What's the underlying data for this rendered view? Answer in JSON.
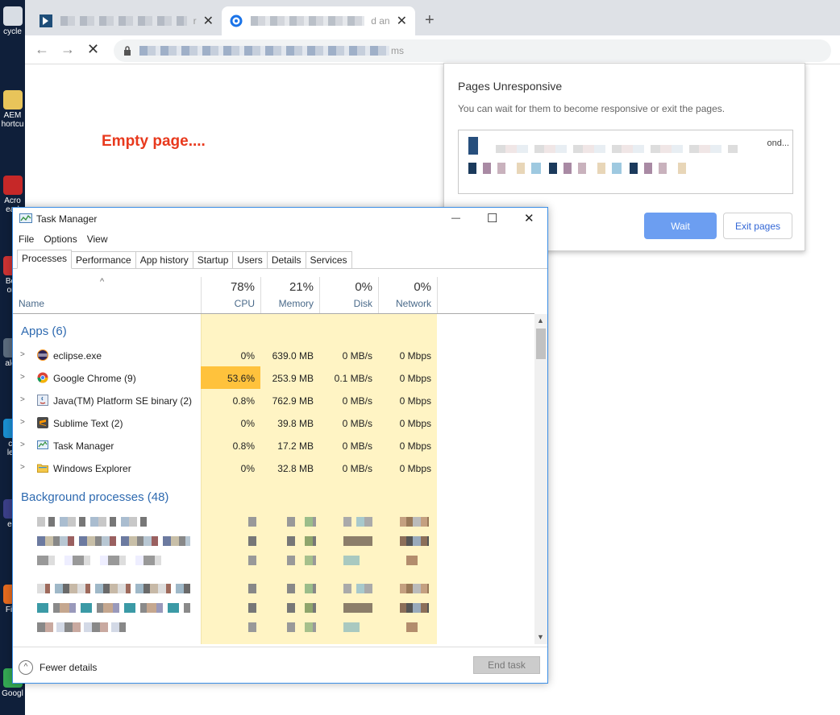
{
  "desktop": {
    "icons": [
      {
        "label": "cycle",
        "color": "#d8dde4"
      },
      {
        "label": "AEM\nhortcu",
        "color": "#e8c45a"
      },
      {
        "label": "Acro\nead",
        "color": "#c62828"
      },
      {
        "label": "Bey\nom",
        "color": "#cc3333"
      },
      {
        "label": "alcu",
        "color": "#5b6b7d"
      },
      {
        "label": "co\nlee",
        "color": "#1a8fd1"
      },
      {
        "label": "ecl",
        "color": "#3b3f88"
      },
      {
        "label": "Fire",
        "color": "#e66a1e"
      },
      {
        "label": "Googl",
        "color": "#34a853"
      }
    ]
  },
  "browser": {
    "tabs": [
      {
        "title_tail": "r",
        "close": "✕"
      },
      {
        "title_tail": "d an",
        "close": "✕"
      }
    ],
    "new_tab": "+",
    "back": "←",
    "forward": "→",
    "stop": "✕",
    "url_tail": "ms",
    "page_text": "Empty page...."
  },
  "dialog": {
    "title": "Pages Unresponsive",
    "message": "You can wait for them to become responsive or exit the pages.",
    "row1_tail": "ond...",
    "wait_label": "Wait",
    "exit_label": "Exit pages"
  },
  "task_manager": {
    "title": "Task Manager",
    "menu": [
      "File",
      "Options",
      "View"
    ],
    "tabs": [
      "Processes",
      "Performance",
      "App history",
      "Startup",
      "Users",
      "Details",
      "Services"
    ],
    "sort_arrow": "^",
    "columns": {
      "name": "Name",
      "cpu": {
        "pct": "78%",
        "label": "CPU"
      },
      "memory": {
        "pct": "21%",
        "label": "Memory"
      },
      "disk": {
        "pct": "0%",
        "label": "Disk"
      },
      "network": {
        "pct": "0%",
        "label": "Network"
      }
    },
    "apps_group": "Apps (6)",
    "apps": [
      {
        "name": "eclipse.exe",
        "cpu": "0%",
        "memory": "639.0 MB",
        "disk": "0 MB/s",
        "network": "0 Mbps",
        "icon": "eclipse-icon"
      },
      {
        "name": "Google Chrome (9)",
        "cpu": "53.6%",
        "memory": "253.9 MB",
        "disk": "0.1 MB/s",
        "network": "0 Mbps",
        "icon": "chrome-icon"
      },
      {
        "name": "Java(TM) Platform SE binary (2)",
        "cpu": "0.8%",
        "memory": "762.9 MB",
        "disk": "0 MB/s",
        "network": "0 Mbps",
        "icon": "java-icon"
      },
      {
        "name": "Sublime Text (2)",
        "cpu": "0%",
        "memory": "39.8 MB",
        "disk": "0 MB/s",
        "network": "0 Mbps",
        "icon": "sublime-icon"
      },
      {
        "name": "Task Manager",
        "cpu": "0.8%",
        "memory": "17.2 MB",
        "disk": "0 MB/s",
        "network": "0 Mbps",
        "icon": "task-manager-icon"
      },
      {
        "name": "Windows Explorer",
        "cpu": "0%",
        "memory": "32.8 MB",
        "disk": "0 MB/s",
        "network": "0 Mbps",
        "icon": "folder-icon"
      }
    ],
    "bg_group": "Background processes (48)",
    "fewer_details": "Fewer details",
    "end_task": "End task",
    "minimize": "—",
    "maximize": "☐",
    "close": "✕"
  }
}
